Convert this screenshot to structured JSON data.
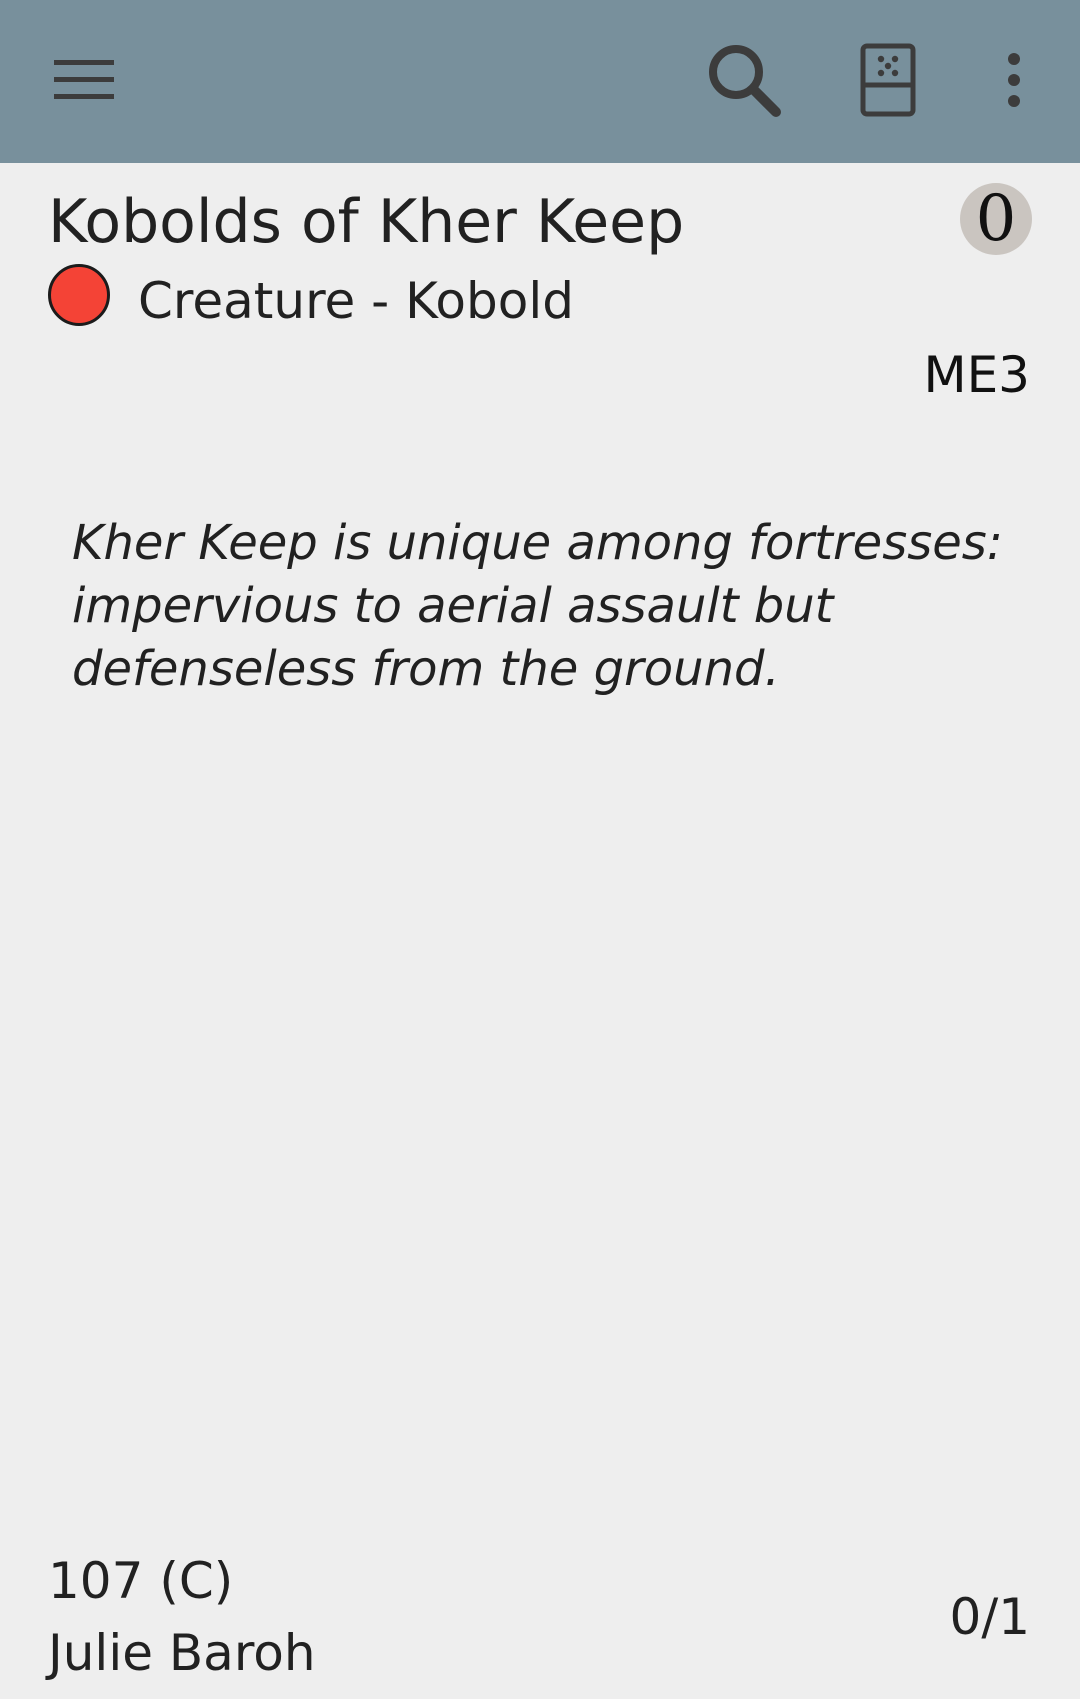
{
  "toolbar": {
    "background_color": "#78909c",
    "menu_icon": "hamburger-menu-icon",
    "search_icon": "search-icon",
    "random_icon": "random-card-icon",
    "overflow_icon": "more-vertical-icon"
  },
  "card": {
    "name": "Kobolds of Kher Keep",
    "mana_cost": "0",
    "color": "#f44336",
    "type_line": "Creature - Kobold",
    "set_code": "ME3",
    "flavor_text": "Kher Keep is unique among fortresses: impervious to aerial assault but defenseless from the ground.",
    "collector_number": "107 (C)",
    "artist": "Julie Baroh",
    "power_toughness": "0/1"
  }
}
